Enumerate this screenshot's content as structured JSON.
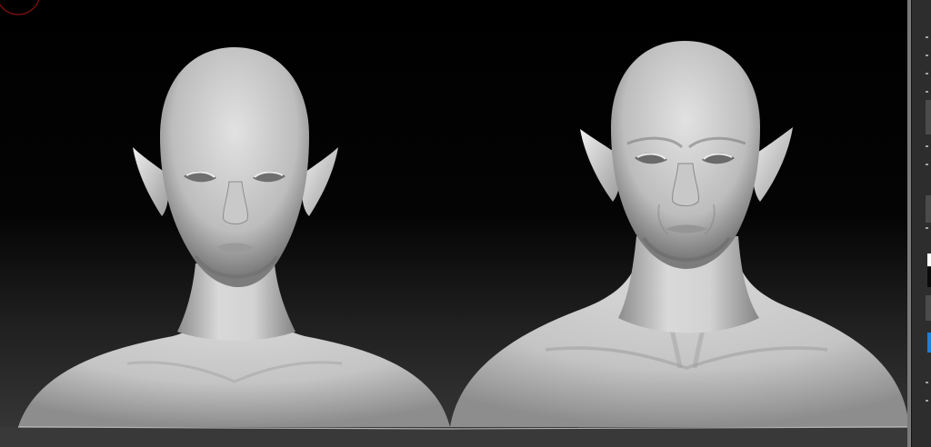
{
  "app": {
    "kind": "3D sculpting viewport",
    "colors": {
      "background": "#000000",
      "floor": "#393939",
      "model": "#cfcfcf",
      "ruler": "#7a7a7a",
      "panel": "#2d2d2d",
      "accent_blue": "#1f7ed6",
      "cursor_ring": "#8a1111"
    }
  },
  "viewport": {
    "models": [
      {
        "name": "female-elf-bust"
      },
      {
        "name": "male-elf-bust"
      }
    ],
    "cursor_icon": "brush-cursor-ring"
  },
  "side_panel": {
    "swatches": [
      "#ffffff",
      "#0a0a0a",
      "#1f7ed6"
    ]
  }
}
